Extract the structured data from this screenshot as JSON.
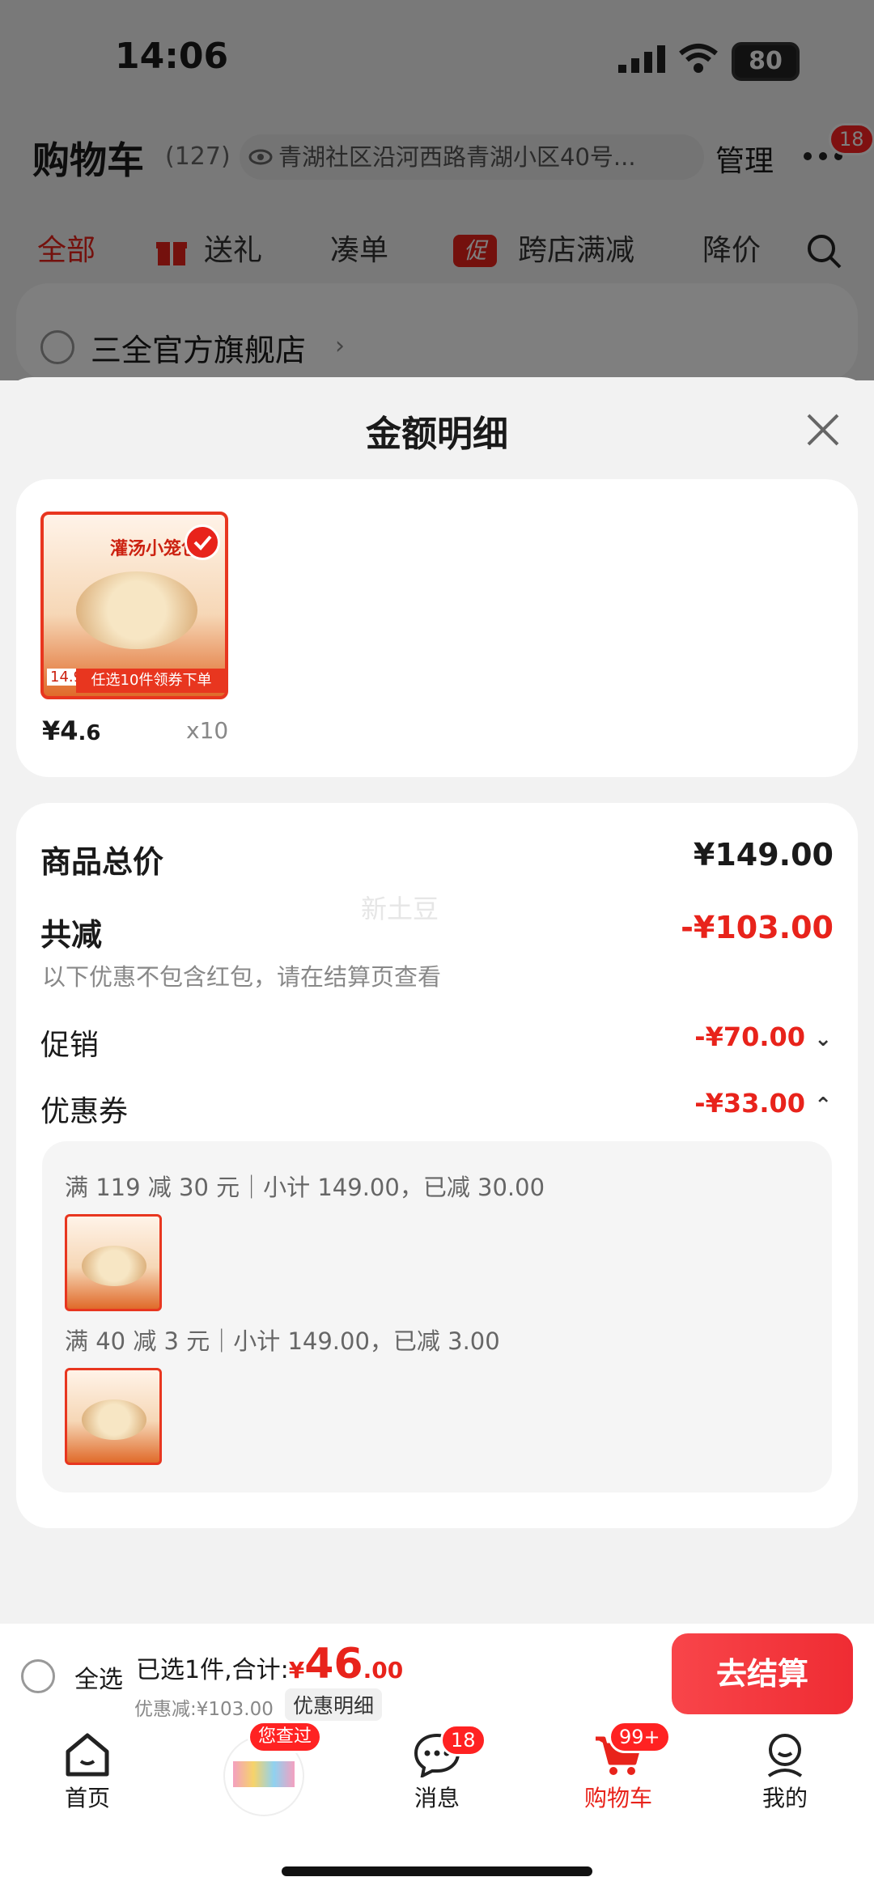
{
  "status": {
    "time": "14:06",
    "battery": "80"
  },
  "header": {
    "title": "购物车",
    "count": "(127)",
    "address": "青湖社区沿河西路青湖小区40号...",
    "manage": "管理",
    "badge": "18"
  },
  "tabs": [
    {
      "label": "全部",
      "active": true
    },
    {
      "label": "送礼"
    },
    {
      "label": "凑单"
    },
    {
      "label": "跨店满减",
      "tag": "促"
    },
    {
      "label": "降价"
    }
  ],
  "shop": {
    "name": "三全官方旗舰店"
  },
  "sheet": {
    "title": "金额明细",
    "product": {
      "price_int": "¥4",
      "price_dec": ".6",
      "qty": "x10",
      "img_title": "灌汤小笼包",
      "img_promo": "任选10件领券下单",
      "img_price": "14.9"
    },
    "summary": {
      "total_label": "商品总价",
      "total_value": "¥149.00",
      "discount_label": "共减",
      "discount_value": "-¥103.00",
      "note": "以下优惠不包含红包，请在结算页查看",
      "promo_label": "促销",
      "promo_value": "-¥70.00",
      "coupon_label": "优惠券",
      "coupon_value": "-¥33.00"
    },
    "coupons": [
      {
        "text": "满 119 减 30 元｜小计 149.00，已减 30.00"
      },
      {
        "text": "满 40 减 3 元｜小计 149.00，已减 3.00"
      }
    ],
    "watermark": "新土豆"
  },
  "bottom_bar": {
    "select_all": "全选",
    "selected": "已选1件,合计:",
    "currency": "¥",
    "total_int": "46",
    "total_dec": ".00",
    "saved": "优惠减:¥103.00",
    "detail_btn": "优惠明细",
    "checkout": "去结算"
  },
  "nav": {
    "home": "首页",
    "viewed_badge": "您查过",
    "messages": "消息",
    "messages_badge": "18",
    "cart": "购物车",
    "cart_badge": "99+",
    "mine": "我的"
  },
  "colors": {
    "accent": "#e8231b",
    "background": "#f2f2f2"
  }
}
